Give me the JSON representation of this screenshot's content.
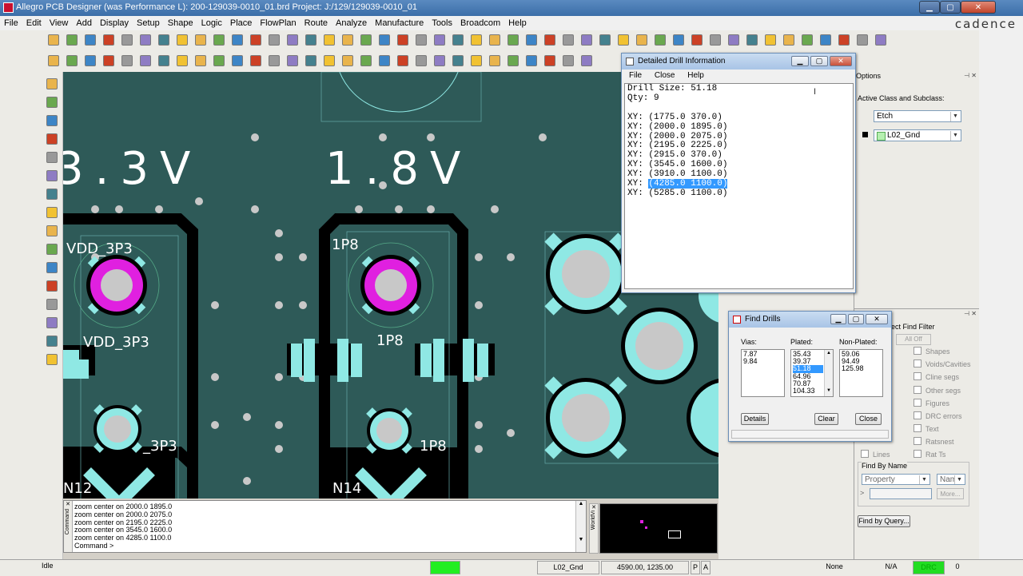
{
  "window": {
    "title": "Allegro PCB Designer (was Performance L): 200-129039-0010_01.brd  Project: J:/129/129039-0010_01",
    "logo": "cadence"
  },
  "menu": [
    "File",
    "Edit",
    "View",
    "Add",
    "Display",
    "Setup",
    "Shape",
    "Logic",
    "Place",
    "FlowPlan",
    "Route",
    "Analyze",
    "Manufacture",
    "Tools",
    "Broadcom",
    "Help"
  ],
  "canvas": {
    "labels": {
      "v33": "3.3V",
      "v18": "1.8V",
      "vdd_top": "VDD_3P3",
      "vdd_mid": "VDD_3P3",
      "p1_top": "1P8",
      "p1_mid": "1P8",
      "p3_bot": "_3P3",
      "p1_bot": "1P8",
      "n12": "N12",
      "n14": "N14"
    },
    "colors": {
      "board": "#2e5a58",
      "etch": "#000000",
      "pad": "#8fe8e4",
      "via": "#c8c8c8",
      "highlight": "#e020e0"
    }
  },
  "options_panel": {
    "header": "Options",
    "active_class_label": "Active Class and Subclass:",
    "class_value": "Etch",
    "subclass_value": "L02_Gnd"
  },
  "find_panel": {
    "header_partial": "ect Find Filter",
    "all_off": "All Off",
    "checkboxes": [
      "Shapes",
      "Voids/Cavities",
      "Cline segs",
      "Other segs",
      "Figures",
      "DRC errors",
      "Text",
      "Ratsnest",
      "Rat Ts"
    ],
    "lines": "Lines",
    "find_by_name": "Find By Name",
    "property": "Property",
    "name": "Name",
    "more": "More...",
    "find_by_query": "Find by Query..."
  },
  "drill_info": {
    "title": "Detailed Drill Information",
    "menu": [
      "File",
      "Close",
      "Help"
    ],
    "drill_size_line": "Drill Size: 51.18",
    "qty_line": "Qty: 9",
    "coords_prefix": "XY: ",
    "coords": [
      "(1775.0 370.0)",
      "(2000.0 1895.0)",
      "(2000.0 2075.0)",
      "(2195.0 2225.0)",
      "(2915.0 370.0)",
      "(3545.0 1600.0)",
      "(3910.0 1100.0)",
      "(4285.0 1100.0)",
      "(5285.0 1100.0)"
    ],
    "selected_index": 7
  },
  "find_drills": {
    "title": "Find Drills",
    "vias_label": "Vias:",
    "plated_label": "Plated:",
    "nonplated_label": "Non-Plated:",
    "vias": [
      "7.87",
      "9.84"
    ],
    "plated": [
      "35.43",
      "39.37",
      "51.18",
      "64.96",
      "70.87",
      "104.33"
    ],
    "plated_selected": 2,
    "nonplated": [
      "59.06",
      "94.49",
      "125.98"
    ],
    "details": "Details",
    "clear": "Clear",
    "close": "Close"
  },
  "console": {
    "lines": [
      "zoom center on 2000.0 1895.0",
      "zoom center on 2000.0 2075.0",
      "zoom center on 2195.0 2225.0",
      "zoom center on 3545.0 1600.0",
      "zoom center on 4285.0 1100.0",
      "Command >"
    ],
    "side_label_left": "Command",
    "side_label_right": "WorldVi"
  },
  "status": {
    "state": "Idle",
    "subclass": "L02_Gnd",
    "coords": "4590.00, 1235.00",
    "p": "P",
    "a": "A",
    "none": "None",
    "na": "N/A",
    "drc": "DRC",
    "count": "0"
  }
}
